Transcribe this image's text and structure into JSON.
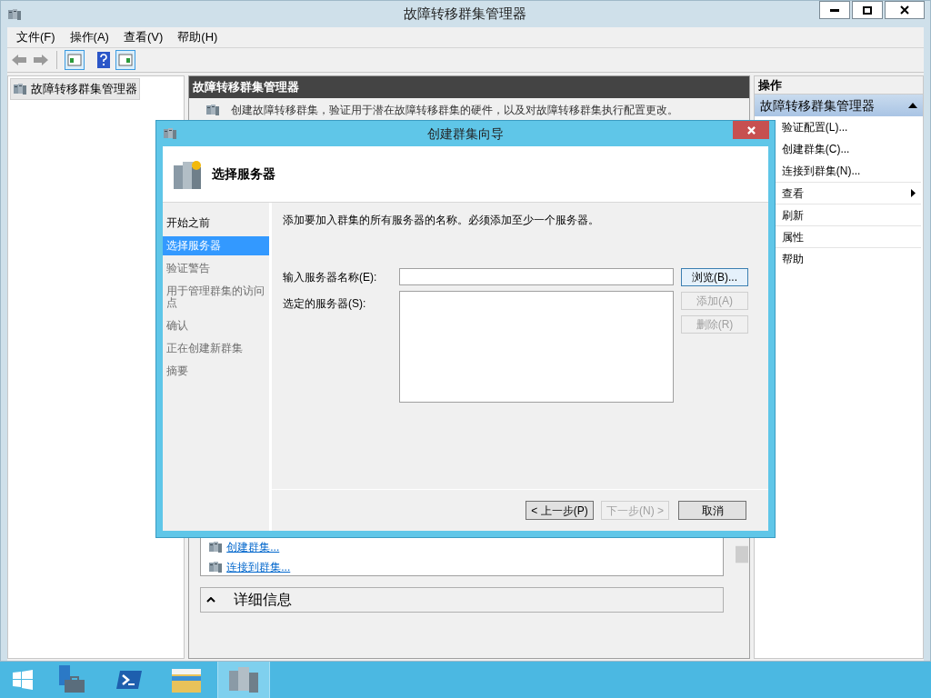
{
  "window": {
    "title": "故障转移群集管理器"
  },
  "menu": [
    "文件(F)",
    "操作(A)",
    "查看(V)",
    "帮助(H)"
  ],
  "tree": [
    {
      "label": "故障转移群集管理器",
      "selected": true
    }
  ],
  "center": {
    "header": "故障转移群集管理器",
    "description": "创建故障转移群集，验证用于潜在故障转移群集的硬件，以及对故障转移群集执行配置更改。",
    "links": [
      "创建群集...",
      "连接到群集..."
    ],
    "details": {
      "title": "详细信息",
      "expanded": true
    }
  },
  "actions": {
    "header": "操作",
    "group": {
      "title": "故障转移群集管理器",
      "expanded": true
    },
    "items": [
      {
        "label": "验证配置(L)...",
        "kind": "item"
      },
      {
        "label": "创建群集(C)...",
        "kind": "item"
      },
      {
        "label": "连接到群集(N)...",
        "kind": "item"
      },
      {
        "label": "查看",
        "kind": "submenu"
      },
      {
        "label": "刷新",
        "kind": "item"
      },
      {
        "label": "属性",
        "kind": "item"
      },
      {
        "label": "帮助",
        "kind": "item"
      }
    ]
  },
  "dialog": {
    "title": "创建群集向导",
    "page_title": "选择服务器",
    "steps": [
      {
        "label": "开始之前",
        "selected": false,
        "disabled": false
      },
      {
        "label": "选择服务器",
        "selected": true,
        "disabled": false
      },
      {
        "label": "验证警告",
        "selected": false,
        "disabled": true
      },
      {
        "label": "用于管理群集的访问点",
        "selected": false,
        "disabled": true
      },
      {
        "label": "确认",
        "selected": false,
        "disabled": true
      },
      {
        "label": "正在创建新群集",
        "selected": false,
        "disabled": true
      },
      {
        "label": "摘要",
        "selected": false,
        "disabled": true
      }
    ],
    "instruction": "添加要加入群集的所有服务器的名称。必须添加至少一个服务器。",
    "server_name_label": "输入服务器名称(E):",
    "selected_servers_label": "选定的服务器(S):",
    "side_buttons": [
      {
        "label": "浏览(B)...",
        "disabled": false
      },
      {
        "label": "添加(A)",
        "disabled": true
      },
      {
        "label": "删除(R)",
        "disabled": true
      }
    ],
    "footer_buttons": [
      {
        "label": "< 上一步(P)",
        "disabled": false
      },
      {
        "label": "下一步(N) >",
        "disabled": true
      },
      {
        "label": "取消",
        "disabled": false
      }
    ]
  },
  "taskbar": [
    {
      "kind": "server-manager",
      "selected": false
    },
    {
      "kind": "powershell",
      "selected": false
    },
    {
      "kind": "explorer",
      "selected": false
    },
    {
      "kind": "cluster",
      "selected": true
    }
  ]
}
